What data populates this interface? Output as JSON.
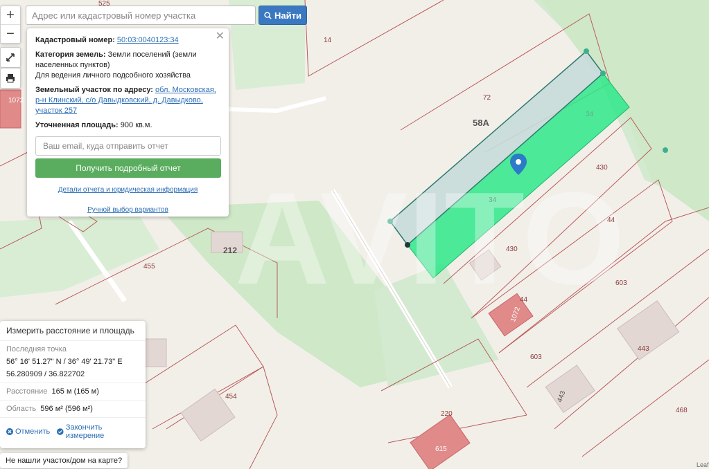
{
  "map": {
    "watermark": "AVITO",
    "parcel_labels": [
      "525",
      "14",
      "72",
      "58А",
      "34",
      "430",
      "44",
      "603",
      "443",
      "468",
      "220",
      "454",
      "455",
      "212",
      "1072",
      "1072"
    ],
    "highlighted_parcel_label_top": "34",
    "highlighted_parcel_label_bottom": "34",
    "attribution": "Leaf",
    "colors": {
      "parcel_border": "#b95c5c",
      "selected_fill": "#2ee88a",
      "measure_fill": "#c7dcda",
      "green_area": "#cfe8c8",
      "building": "#e3d7d3",
      "building_red": "#e08a8a"
    }
  },
  "controls": {
    "zoom_in": "+",
    "zoom_out": "−",
    "fullscreen_icon": "expand-icon",
    "print_icon": "printer-icon"
  },
  "search": {
    "placeholder": "Адрес или кадастровый номер участка",
    "button_label": "Найти"
  },
  "info": {
    "cadastral_label": "Кадастровый номер:",
    "cadastral_value": "50:03:0040123:34",
    "category_label": "Категория земель:",
    "category_value": "Земли поселений (земли населенных пунктов)",
    "use_value": "Для ведения личного подсобного хозяйства",
    "address_label": "Земельный участок по адресу:",
    "address_value": "обл. Московская, р-н Клинский, с/о Давыдковский, д. Давыдково, участок 257",
    "area_label": "Уточненная площадь:",
    "area_value": "900 кв.м.",
    "email_placeholder": "Ваш email, куда отправить отчет",
    "report_button": "Получить подробный отчет",
    "details_link": "Детали отчета и юридическая информация",
    "manual_link": "Ручной выбор вариантов"
  },
  "measure": {
    "title": "Измерить расстояние и площадь",
    "last_point_label": "Последняя точка",
    "coords_dms": "56° 16' 51.27\" N / 36° 49' 21.73\" E",
    "coords_dec": "56.280909 / 36.822702",
    "distance_label": "Расстояние",
    "distance_value": "165 м (165 м)",
    "area_label": "Область",
    "area_value": "596 м² (596 м²)",
    "cancel": "Отменить",
    "finish": "Закончить измерение"
  },
  "not_found": "Не нашли участок/дом на карте?"
}
